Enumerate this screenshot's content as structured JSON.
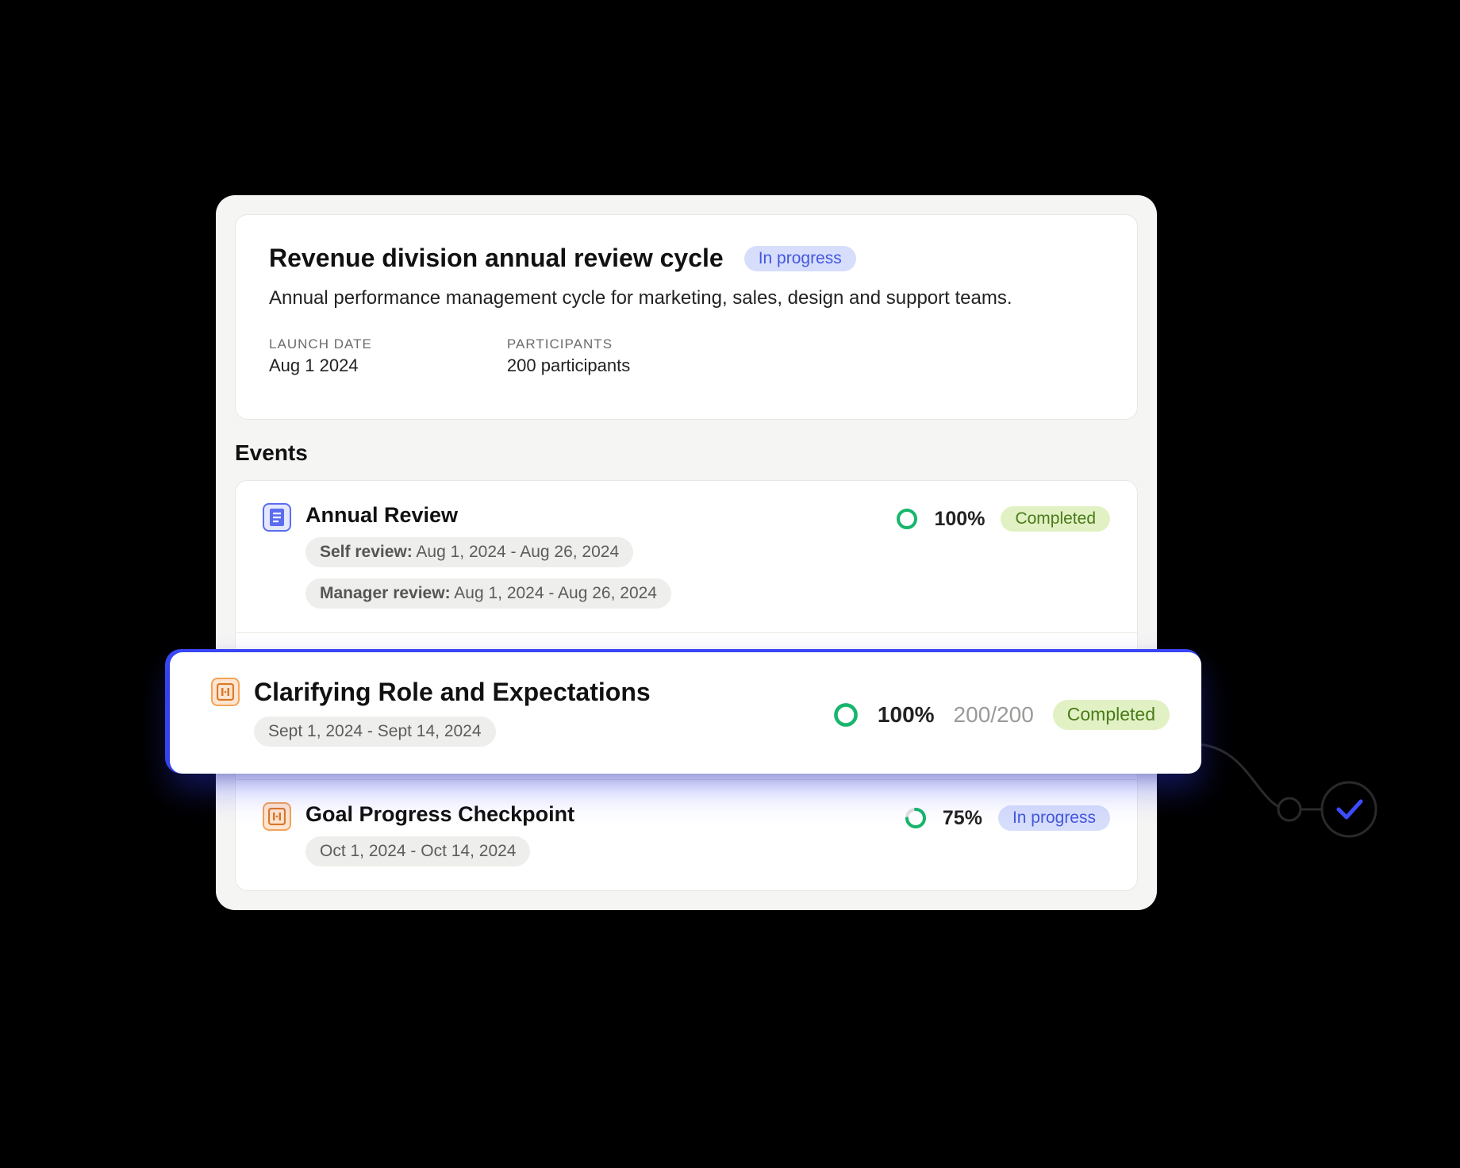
{
  "header": {
    "title": "Revenue division annual review cycle",
    "status": "In progress",
    "description": "Annual performance management cycle for marketing, sales, design and support teams.",
    "launch": {
      "label": "LAUNCH DATE",
      "value": "Aug 1 2024"
    },
    "participants": {
      "label": "PARTICIPANTS",
      "value": "200 participants"
    }
  },
  "sections": {
    "events_title": "Events"
  },
  "events": [
    {
      "title": "Annual Review",
      "self_review": {
        "label": "Self review:",
        "dates": "Aug 1, 2024 - Aug 26, 2024"
      },
      "manager_review": {
        "label": "Manager review:",
        "dates": "Aug 1, 2024 - Aug 26, 2024"
      },
      "percent": "100%",
      "status": "Completed"
    },
    {
      "title": "Clarifying Role and Expectations",
      "dates": "Sept 1, 2024 - Sept 14, 2024",
      "percent": "100%",
      "fraction": "200/200",
      "status": "Completed"
    },
    {
      "title": "Goal Progress Checkpoint",
      "dates": "Oct 1, 2024 - Oct 14, 2024",
      "percent": "75%",
      "status": "In progress"
    }
  ]
}
